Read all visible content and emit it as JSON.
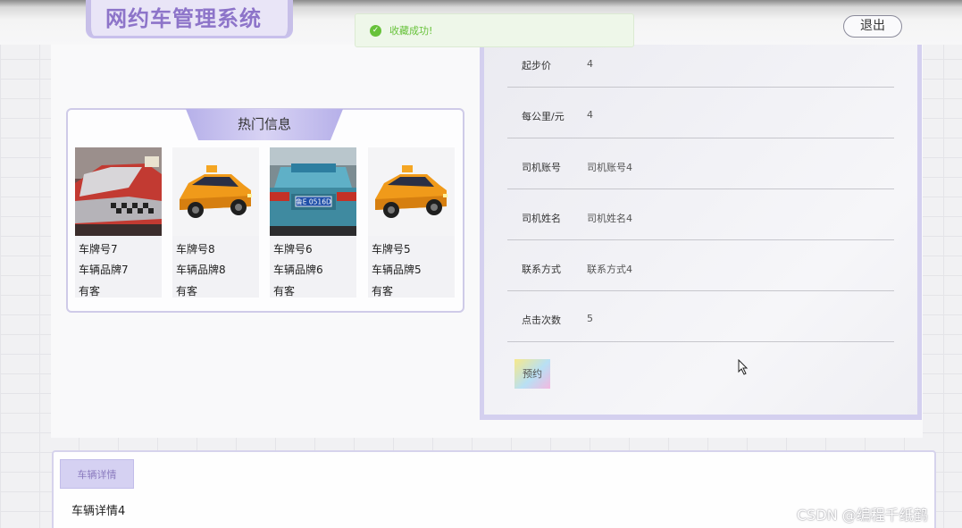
{
  "header": {
    "app_title": "网约车管理系统",
    "logout_label": "退出"
  },
  "toast": {
    "message": "收藏成功!",
    "icon": "check-circle-icon",
    "color": "#67c23a"
  },
  "hot_section": {
    "title": "热门信息",
    "cards": [
      {
        "plate": "车牌号7",
        "brand": "车辆品牌7",
        "status": "有客"
      },
      {
        "plate": "车牌号8",
        "brand": "车辆品牌8",
        "status": "有客"
      },
      {
        "plate": "车牌号6",
        "brand": "车辆品牌6",
        "status": "有客"
      },
      {
        "plate": "车牌号5",
        "brand": "车辆品牌5",
        "status": "有客"
      }
    ],
    "taxi_plate_text": "鲁E 0516D"
  },
  "details": {
    "rows": [
      {
        "label": "起步价",
        "value": "4"
      },
      {
        "label": "每公里/元",
        "value": "4"
      },
      {
        "label": "司机账号",
        "value": "司机账号4"
      },
      {
        "label": "司机姓名",
        "value": "司机姓名4"
      },
      {
        "label": "联系方式",
        "value": "联系方式4"
      },
      {
        "label": "点击次数",
        "value": "5"
      }
    ],
    "book_label": "预约"
  },
  "vehicle_detail": {
    "tab_label": "车辆详情",
    "content": "车辆详情4"
  },
  "watermark": "CSDN @编程千纸鹤",
  "colors": {
    "accent_purple": "#8d74c9",
    "panel_border": "#d4d0ef",
    "success_green": "#67c23a"
  }
}
